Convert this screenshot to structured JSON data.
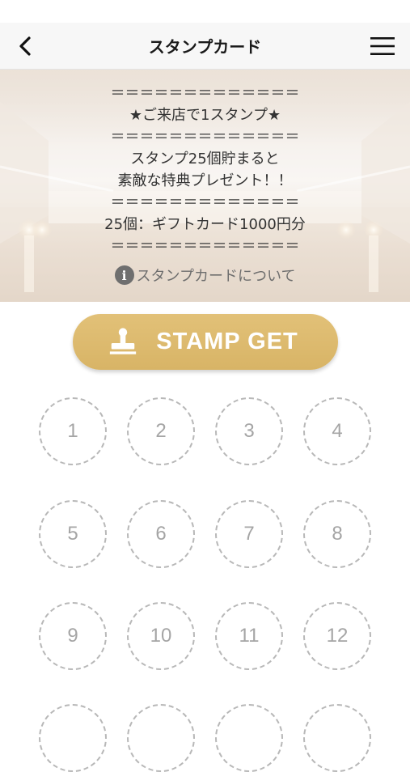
{
  "navbar": {
    "title": "スタンプカード"
  },
  "hero": {
    "lines": [
      "＝＝＝＝＝＝＝＝＝＝＝＝＝",
      "★ご来店で1スタンプ★",
      "＝＝＝＝＝＝＝＝＝＝＝＝＝",
      "スタンプ25個貯まると",
      "素敵な特典プレゼント！！",
      "＝＝＝＝＝＝＝＝＝＝＝＝＝",
      "25個：ギフトカード1000円分",
      "＝＝＝＝＝＝＝＝＝＝＝＝＝"
    ],
    "about_link": "スタンプカードについて",
    "info_icon_glyph": "i"
  },
  "stamp_button": {
    "label": "STAMP GET",
    "color": "#dcb96e"
  },
  "stamps": {
    "slots": [
      "1",
      "2",
      "3",
      "4",
      "5",
      "6",
      "7",
      "8",
      "9",
      "10",
      "11",
      "12",
      "",
      "",
      "",
      ""
    ],
    "collected": 0
  }
}
